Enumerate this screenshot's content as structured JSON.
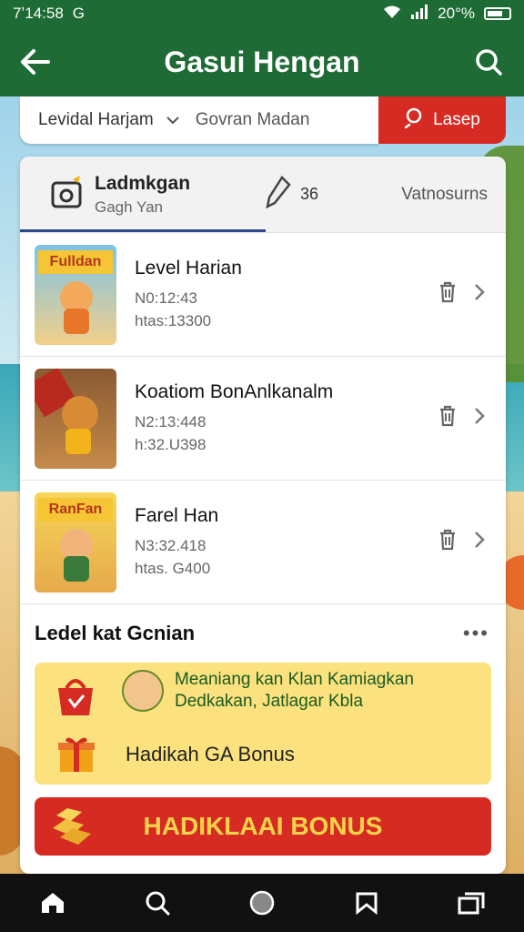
{
  "status_bar": {
    "time": "7ʼ14:58",
    "signal_left": "G",
    "battery": "20°%"
  },
  "app_bar": {
    "title": "Gasui Hengan",
    "back_icon": "arrow-left-icon",
    "search_icon": "search-icon"
  },
  "search": {
    "select_value": "Levidal Harjam",
    "placeholder": "Govran Madan",
    "button_label": "Lasep"
  },
  "tabs": [
    {
      "title": "Ladmkgan",
      "subtitle": "Gagh Yan",
      "icon": "camera-icon"
    },
    {
      "label": "36",
      "icon": "pen-icon"
    },
    {
      "label": "Vatnosurns"
    }
  ],
  "items": [
    {
      "title": "Level Harian",
      "line1": "N0:12:43",
      "line2": "htas:13300",
      "thumb_label": "Fulldan"
    },
    {
      "title": "Koatiom BonAnlkanalm",
      "line1": "N2:13:448",
      "line2": "h:32.U398",
      "thumb_label": ""
    },
    {
      "title": "Farel Han",
      "line1": "N3:32.418",
      "line2": "htas. G400",
      "thumb_label": "RanFan"
    }
  ],
  "section": {
    "title": "Ledel kat Gcnian"
  },
  "promo": {
    "line1": "Meaniang kan Klan Kamiagkan",
    "line2": "Dedkakan, Jatlagar Kbla",
    "line3": "Hadikah GA Bonus"
  },
  "bonus": {
    "label": "HADIKLAAI BONUS"
  },
  "nav": [
    "home-icon",
    "search-icon",
    "circle-icon",
    "bookmark-icon",
    "tabs-icon"
  ],
  "colors": {
    "primary": "#1f6b35",
    "accent": "#d62b23",
    "promo_bg": "#fbe27e",
    "gold": "#f8d34a"
  }
}
